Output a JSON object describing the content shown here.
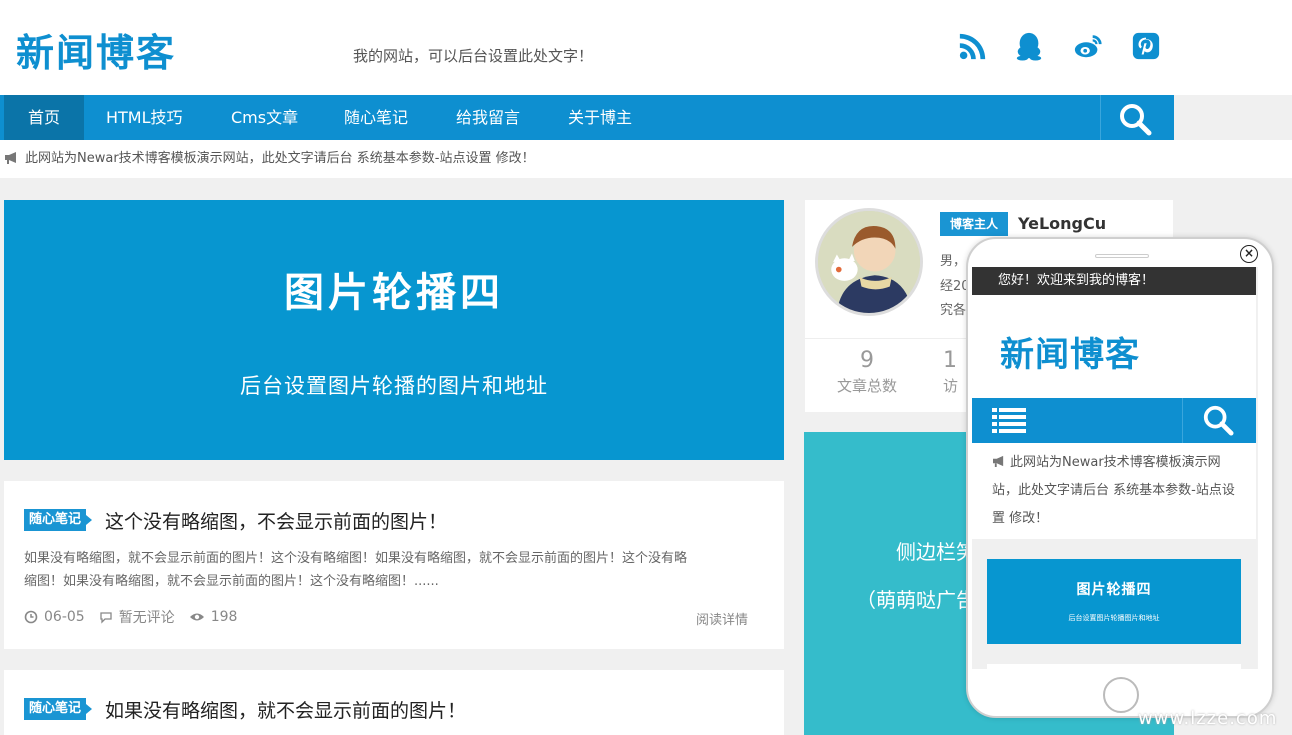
{
  "header": {
    "logo": "新闻博客",
    "tagline": "我的网站，可以后台设置此处文字！"
  },
  "social_icons": [
    "rss-icon",
    "qq-icon",
    "weibo-icon",
    "pinterest-icon"
  ],
  "nav": {
    "items": [
      {
        "label": "首页",
        "active": true
      },
      {
        "label": "HTML技巧"
      },
      {
        "label": "Cms文章"
      },
      {
        "label": "随心笔记"
      },
      {
        "label": "给我留言"
      },
      {
        "label": "关于博主"
      }
    ]
  },
  "notice": "此网站为Newar技术博客模板演示网站，此处文字请后台 系统基本参数-站点设置 修改！",
  "banner": {
    "title": "图片轮播四",
    "subtitle": "后台设置图片轮播的图片和地址"
  },
  "posts": [
    {
      "tag": "随心笔记",
      "title": "这个没有略缩图，不会显示前面的图片！",
      "excerpt_line1": "如果没有略缩图，就不会显示前面的图片！这个没有略缩图！如果没有略缩图，就不会显示前面的图片！这个没有略",
      "excerpt_line2": "缩图！如果没有略缩图，就不会显示前面的图片！这个没有略缩图！......",
      "date": "06-05",
      "comments": "暂无评论",
      "views": "198",
      "read_more": "阅读详情"
    },
    {
      "tag": "随心笔记",
      "title": "如果没有略缩图，就不会显示前面的图片！"
    }
  ],
  "profile": {
    "badge": "博客主人",
    "name": "YeLongCu",
    "line1": "男，",
    "line2": "经20",
    "line3": "究各",
    "stats": [
      {
        "num": "9",
        "label": "文章总数"
      },
      {
        "num": "1",
        "label": "访"
      }
    ]
  },
  "ad": {
    "line1": "侧边栏笑",
    "line2": "（萌萌哒广告"
  },
  "mobile": {
    "welcome": "您好！欢迎来到我的博客！",
    "logo": "新闻博客",
    "notice": "此网站为Newar技术博客模板演示网站，此处文字请后台 系统基本参数-站点设置 修改！",
    "banner_title": "图片轮播四",
    "banner_sub": "后台设置图片轮播图片和地址",
    "close": "×"
  },
  "watermark": "www.lzze.com",
  "colors": {
    "brand_blue": "#0e8fd0",
    "banner_blue": "#0796d0",
    "ad_teal": "#35bccb"
  }
}
